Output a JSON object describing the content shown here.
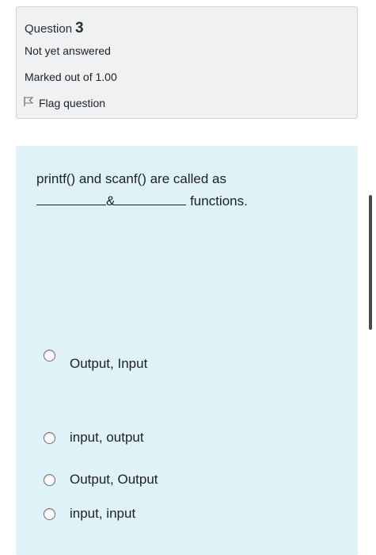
{
  "info": {
    "question_label": "Question",
    "question_number": "3",
    "state": "Not yet answered",
    "grade": "Marked out of 1.00",
    "flag_label": "Flag question",
    "flag_icon": "flag-icon"
  },
  "question": {
    "line1": "printf() and scanf() are called as",
    "amp": "&",
    "suffix": "functions."
  },
  "options": [
    {
      "label": "Output, Input"
    },
    {
      "label": "input, output"
    },
    {
      "label": "Output, Output"
    },
    {
      "label": "input, input"
    }
  ]
}
